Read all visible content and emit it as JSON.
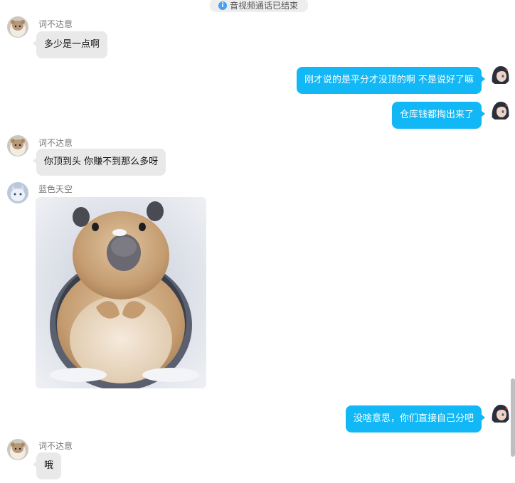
{
  "system_notice": {
    "icon": "info-icon",
    "text": "音视频通话已结束"
  },
  "messages": [
    {
      "sender": "词不达意",
      "direction": "in",
      "avatar": "hamster-avatar",
      "text": "多少是一点啊"
    },
    {
      "direction": "out",
      "avatar": "anime-girl-avatar",
      "text": "刚才说的是平分才没顶的啊 不是说好了嘛"
    },
    {
      "direction": "out",
      "avatar": "anime-girl-avatar",
      "text": "仓库钱都掏出来了"
    },
    {
      "sender": "词不达意",
      "direction": "in",
      "avatar": "hamster-avatar",
      "text": "你顶到头 你赚不到那么多呀"
    },
    {
      "sender": "蓝色天空",
      "direction": "in",
      "avatar": "cat-avatar",
      "image": "capybara-in-snow-image"
    },
    {
      "direction": "out",
      "avatar": "anime-girl-avatar",
      "text": "没啥意思，你们直接自己分吧"
    },
    {
      "sender": "词不达意",
      "direction": "in",
      "avatar": "hamster-avatar",
      "text": "哦"
    }
  ],
  "colors": {
    "outgoing_bubble": "#12b7f5",
    "incoming_bubble": "#e9e9ea",
    "notice_background": "#eeeeee",
    "info_icon": "#4aa0f0"
  }
}
